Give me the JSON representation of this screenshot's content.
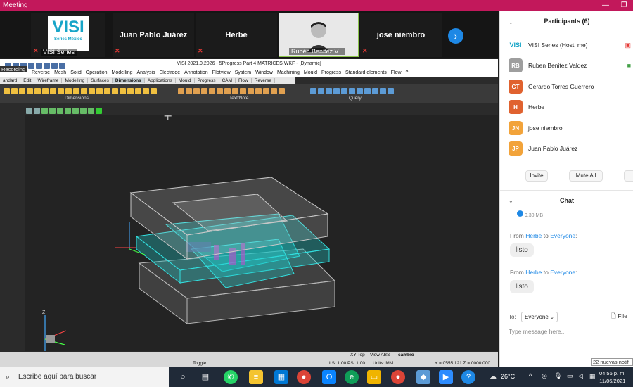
{
  "window": {
    "title": "Meeting"
  },
  "video_strip": {
    "tiles": [
      {
        "name": "VISI Series",
        "logo_text": "VISI",
        "logo_sub": "Series México"
      },
      {
        "name": "Juan Pablo Juárez"
      },
      {
        "name": "Herbe"
      },
      {
        "name": "Rubén Benitez V..."
      },
      {
        "name": "jose niembro"
      }
    ]
  },
  "visi": {
    "title": "VISI 2021.0.2026 - 5Progress Part 4 MATRICES.WKF - [Dynamic]",
    "recording": "Recording",
    "menu": [
      "Reverse",
      "Mesh",
      "Solid",
      "Operation",
      "Modelling",
      "Analysis",
      "Electrode",
      "Annotation",
      "Plotview",
      "System",
      "Window",
      "Machining",
      "Mould",
      "Progress",
      "Standard elements",
      "Flow",
      "?"
    ],
    "tabs": [
      "andard",
      "Edit",
      "Wireframe",
      "Modelling",
      "Surfaces",
      "Dimensions",
      "Applications",
      "Mould",
      "Progress",
      "CAM",
      "Flow",
      "Reverse"
    ],
    "active_tab": "Dimensions",
    "ribbon_groups": [
      "Dimensions",
      "Text/Note",
      "Query"
    ],
    "status": {
      "toggle": "Toggle",
      "view": "View ABS",
      "mode": "cambio",
      "xy": "XY Top",
      "ls": "LS: 1.00 PS: 1.00",
      "units": "Units: MM",
      "coords": "Y = 0555.121 Z = 0000.000"
    }
  },
  "participants": {
    "title": "Participants (6)",
    "list": [
      {
        "name": "VISI Series (Host, me)",
        "initials": "VISI",
        "color": "#ffffff"
      },
      {
        "name": "Ruben Benitez Valdez",
        "initials": "RB",
        "color": "#9e9e9e"
      },
      {
        "name": "Gerardo Torres Guerrero",
        "initials": "GT",
        "color": "#e0622f"
      },
      {
        "name": "Herbe",
        "initials": "H",
        "color": "#e0622f"
      },
      {
        "name": "jose niembro",
        "initials": "JN",
        "color": "#f2a33a"
      },
      {
        "name": "Juan Pablo Juárez",
        "initials": "JP",
        "color": "#f2a33a"
      }
    ],
    "invite": "Invite",
    "mute_all": "Mute All",
    "more": "..."
  },
  "chat": {
    "title": "Chat",
    "file_size": "9.30 MB",
    "messages": [
      {
        "from": "Herbe",
        "to": "Everyone",
        "text": "listo"
      },
      {
        "from": "Herbe",
        "to": "Everyone",
        "text": "listo"
      }
    ],
    "from_label": "From",
    "to_word": "to",
    "to_label": "To:",
    "recipient": "Everyone",
    "file_label": "File",
    "placeholder": "Type message here..."
  },
  "taskbar": {
    "search": "Escribe aquí para buscar",
    "temperature": "26°C",
    "time": "04:56 p. m.",
    "date": "11/06/2021",
    "notification": "22 nuevas notif"
  },
  "colors": {
    "accent": "#c2185b",
    "zoom_blue": "#1e88e5",
    "mold_cyan": "#20c8c8"
  }
}
